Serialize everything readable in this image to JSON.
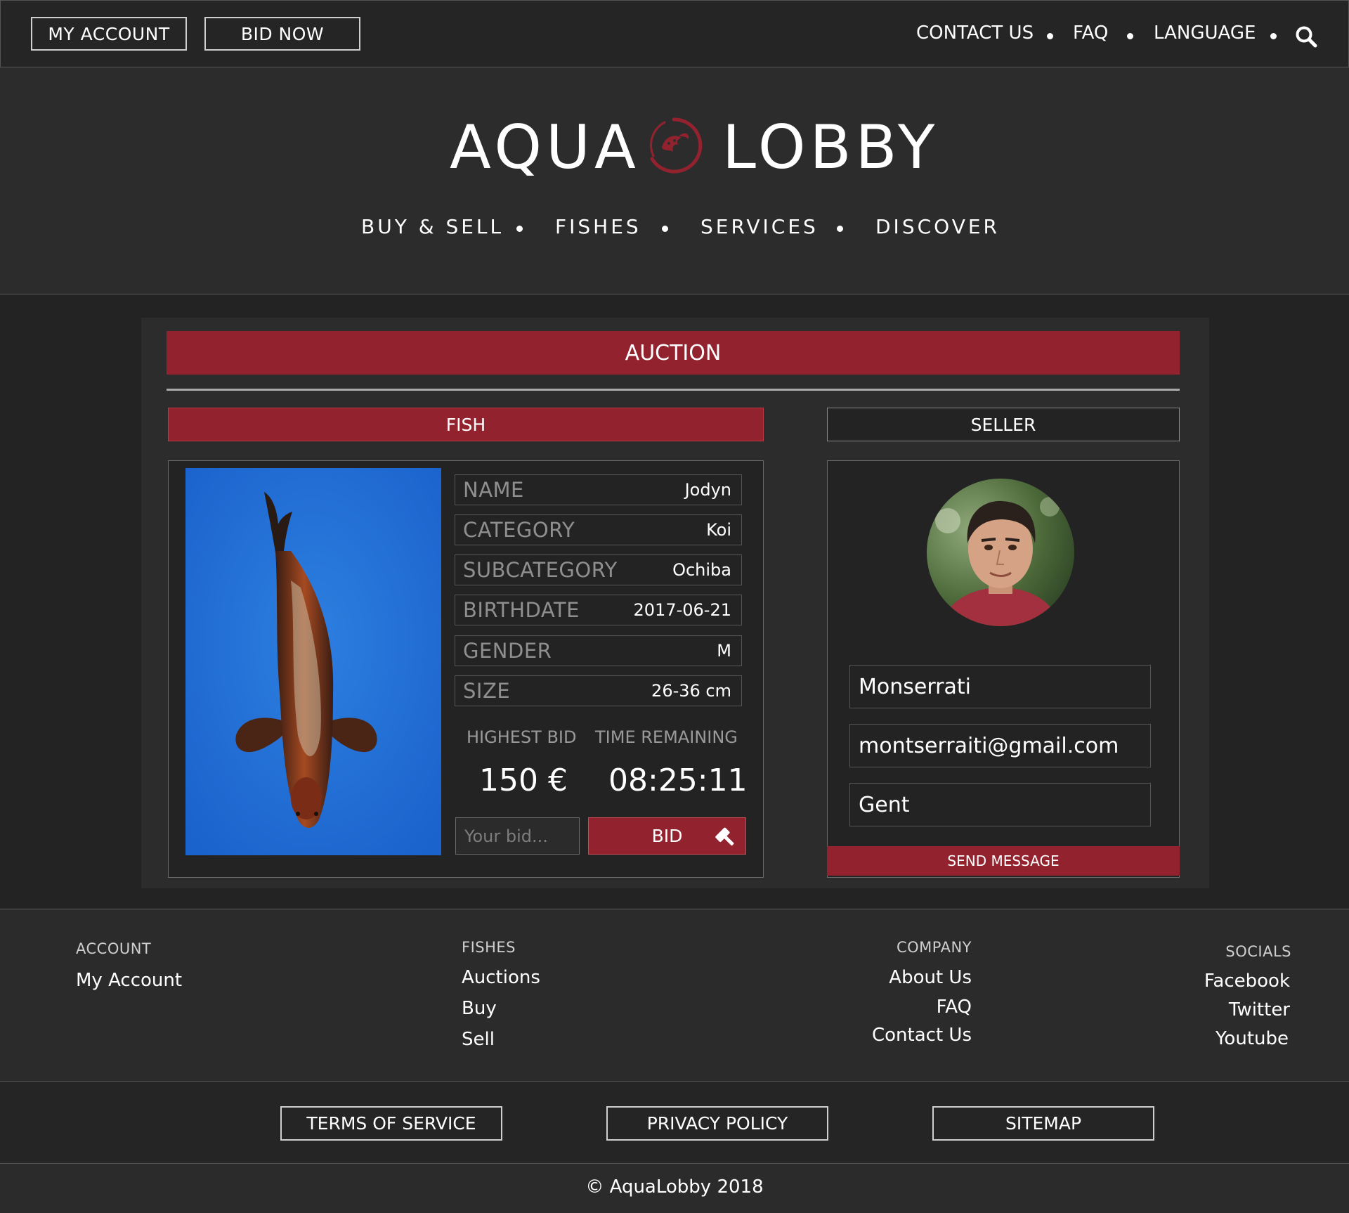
{
  "topbar": {
    "my_account": "MY ACCOUNT",
    "bid_now": "BID NOW",
    "contact_us": "CONTACT US",
    "faq": "FAQ",
    "language": "LANGUAGE",
    "search_icon": "search-icon"
  },
  "brand": {
    "left": "AQUA",
    "right": "LOBBY",
    "logo_icon": "koi-emblem-icon",
    "accent_color": "#93222f"
  },
  "nav": [
    "BUY & SELL",
    "FISHES",
    "SERVICES",
    "DISCOVER"
  ],
  "auction": {
    "title": "AUCTION",
    "fish_tab": "FISH",
    "seller_tab": "SELLER",
    "properties": [
      {
        "label": "NAME",
        "value": "Jodyn"
      },
      {
        "label": "CATEGORY",
        "value": "Koi"
      },
      {
        "label": "SUBCATEGORY",
        "value": "Ochiba"
      },
      {
        "label": "BIRTHDATE",
        "value": "2017-06-21"
      },
      {
        "label": "GENDER",
        "value": "M"
      },
      {
        "label": "SIZE",
        "value": "26-36 cm"
      }
    ],
    "highest_bid_label": "HIGHEST BID",
    "highest_bid_value": "150 €",
    "time_remaining_label": "TIME REMAINING",
    "time_remaining_value": "08:25:11",
    "bid_placeholder": "Your bid...",
    "bid_button": "BID",
    "bid_icon": "gavel-icon"
  },
  "seller": {
    "name": "Monserrati",
    "email": "montserraiti@gmail.com",
    "city": "Gent",
    "send_message": "SEND MESSAGE"
  },
  "footer": {
    "account": {
      "heading": "ACCOUNT",
      "links": [
        "My Account"
      ]
    },
    "fishes": {
      "heading": "FISHES",
      "links": [
        "Auctions",
        "Buy",
        "Sell"
      ]
    },
    "company": {
      "heading": "COMPANY",
      "links": [
        "About Us",
        "FAQ",
        "Contact Us"
      ]
    },
    "socials": {
      "heading": "SOCIALS",
      "links": [
        "Facebook",
        "Twitter",
        "Youtube"
      ]
    }
  },
  "legal": {
    "terms": "TERMS OF SERVICE",
    "privacy": "PRIVACY POLICY",
    "sitemap": "SITEMAP"
  },
  "copyright": "© AquaLobby 2018"
}
